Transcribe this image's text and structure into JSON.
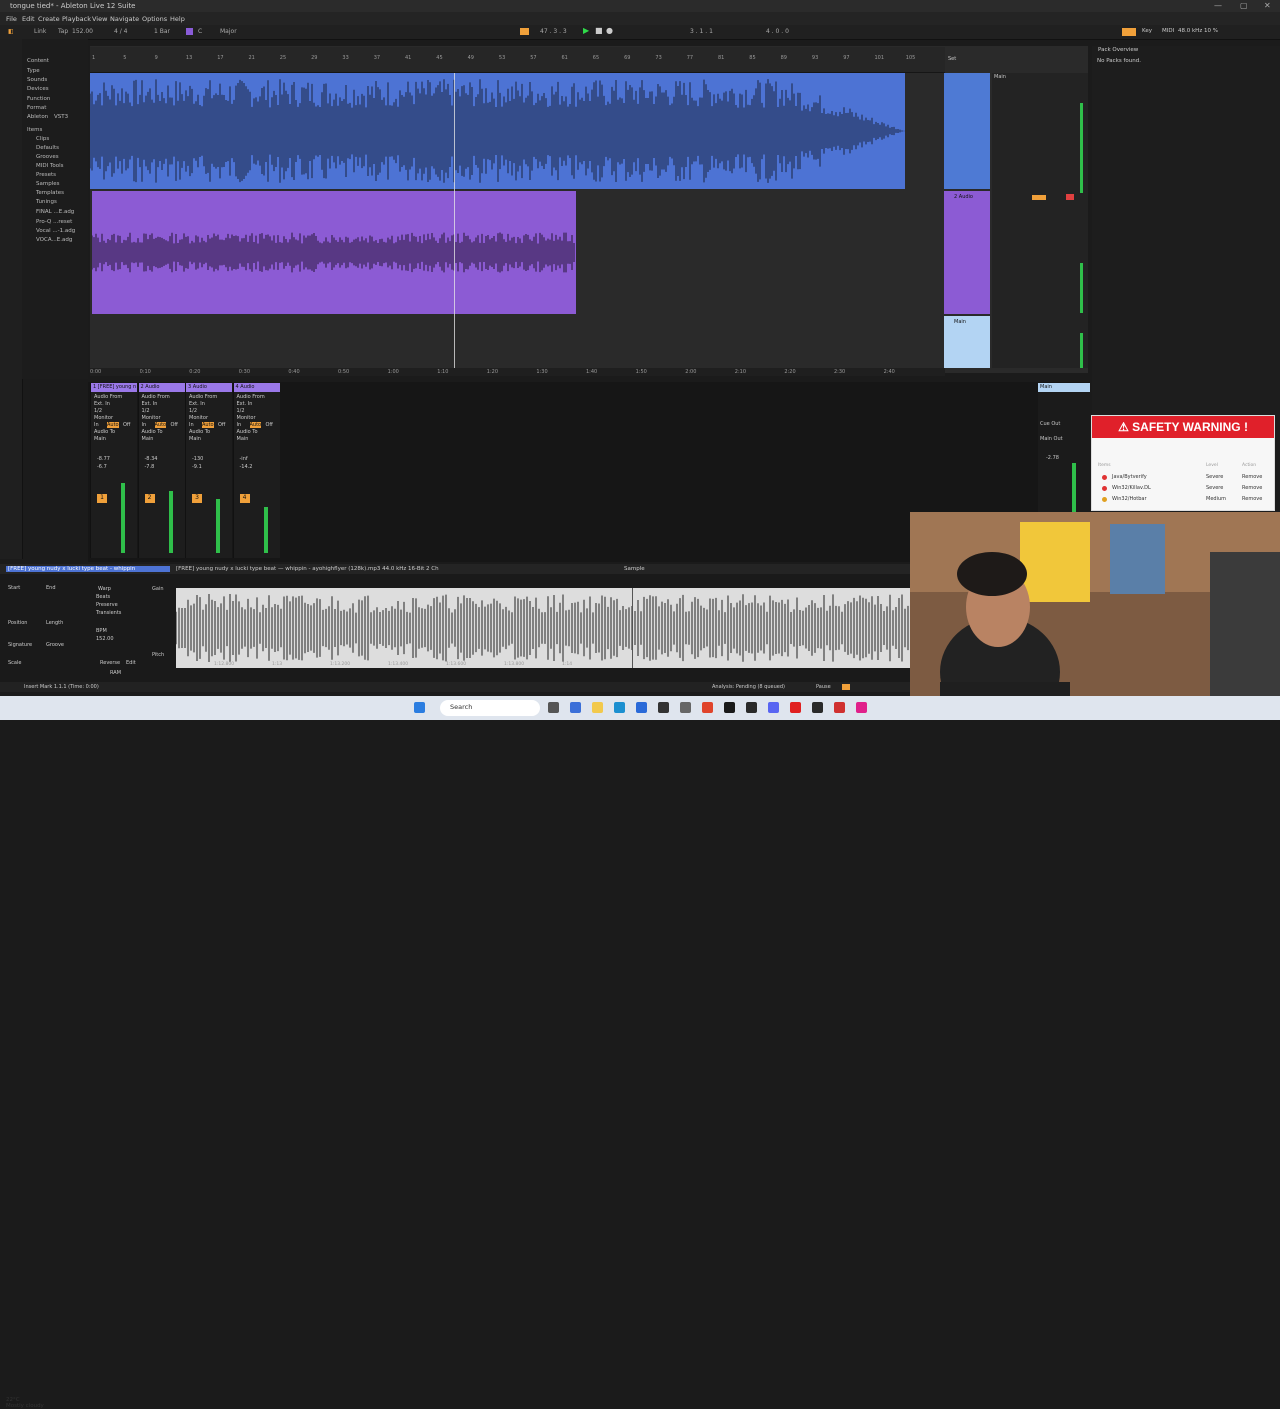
{
  "window": {
    "title": "tongue tied* - Ableton Live 12 Suite",
    "min": "—",
    "max": "▢",
    "close": "✕"
  },
  "menu": [
    "File",
    "Edit",
    "Create",
    "Playback",
    "View",
    "Navigate",
    "Options",
    "Help"
  ],
  "transport": {
    "link": "Link",
    "tap": "Tap",
    "tempo": "152.00",
    "sig": "4 / 4",
    "bar": "1 Bar",
    "key": "C",
    "scale": "Major",
    "position": "47 . 3 . 3",
    "loop_start": "3 . 1 . 1",
    "loop_len": "4 . 0 . 0"
  },
  "top_right": {
    "key": "Key",
    "midi": "MIDI",
    "rate": "48.0 kHz",
    "cpu": "10 %"
  },
  "browser": {
    "items": [
      "Content",
      "Type",
      "Sounds",
      "Devices",
      "Function",
      "Format",
      "Ableton",
      "VST3",
      "Items",
      "Clips",
      "Defaults",
      "Grooves",
      "MIDI Tools",
      "Presets",
      "Samples",
      "Templates",
      "Tunings",
      "FINAL ...E.adg",
      "Pro-Q ...reset",
      "Vocal ...-1.adg",
      "VOCA...E.adg"
    ]
  },
  "ruler_ticks": [
    "1",
    "5",
    "9",
    "13",
    "17",
    "21",
    "25",
    "29",
    "33",
    "37",
    "41",
    "45",
    "49",
    "53",
    "57",
    "61",
    "65",
    "69",
    "73",
    "77",
    "81",
    "85",
    "89",
    "93",
    "97",
    "101",
    "105"
  ],
  "time_ticks": [
    "0:00",
    "0:10",
    "0:20",
    "0:30",
    "0:40",
    "0:50",
    "1:00",
    "1:10",
    "1:20",
    "1:30",
    "1:40",
    "1:50",
    "2:00",
    "2:10",
    "2:20",
    "2:30",
    "2:40"
  ],
  "tracks": {
    "t2": "2 Audio",
    "main": "Main"
  },
  "set_label": "Set",
  "mixer": {
    "strips": [
      {
        "hdr": "1 [FREE] young n",
        "vol": "-8.77",
        "peak": "-6.7",
        "num": "1"
      },
      {
        "hdr": "2 Audio",
        "vol": "-8.34",
        "peak": "-7.8",
        "num": "2"
      },
      {
        "hdr": "3 Audio",
        "vol": "-130",
        "peak": "-9.1",
        "num": "3"
      },
      {
        "hdr": "4 Audio",
        "vol": "-inf",
        "peak": "-14.2",
        "num": "4"
      }
    ],
    "audio_from": "Audio From",
    "ext_in": "Ext. In",
    "ch": "1/2",
    "monitor": "Monitor",
    "in": "In",
    "auto": "Auto",
    "off": "Off",
    "audio_to": "Audio To",
    "main": "Main",
    "master_hdr": "Main",
    "cue_out": "Cue Out",
    "main_out": "Main Out",
    "master_vol": "-2.78"
  },
  "detail": {
    "clip_name": "[FREE] young nudy x lucki type beat - whippin",
    "file_info": "[FREE] young nudy x lucki type beat — whippin - ayohighflyer (128k).mp3  44.0 kHz  16-Bit  2 Ch",
    "sample": "Sample",
    "start": "Start",
    "end": "End",
    "position": "Position",
    "length": "Length",
    "signature": "Signature",
    "groove": "Groove",
    "scale": "Scale",
    "warp": "Warp",
    "beats": "Beats",
    "preserve": "Preserve",
    "transients": "Transients",
    "bpm": "BPM",
    "bpm_val": "152.00",
    "gain": "Gain",
    "pitch": "Pitch",
    "reverse": "Reverse",
    "edit": "Edit",
    "ram": "RAM",
    "time_marks": [
      "1:12.800",
      "1:13",
      "1:13.200",
      "1:13.400",
      "1:13.600",
      "1:13.800",
      "1:14"
    ]
  },
  "status": {
    "left": "Insert Mark 1.1.1 (Time: 0:00)",
    "right": "Analysis: Pending (8 queued)",
    "pause": "Pause"
  },
  "right_panel": {
    "title": "Pack Overview",
    "msg": "No Packs found."
  },
  "safety_popup": {
    "title": "⚠ SAFETY WARNING !",
    "cols": [
      "Items",
      "Level",
      "Action"
    ],
    "rows": [
      {
        "name": "Java/Bytverify",
        "level": "Severe",
        "action": "Remove",
        "dot": "#e03333"
      },
      {
        "name": "Win32/Killav.DL",
        "level": "Severe",
        "action": "Remove",
        "dot": "#e03333"
      },
      {
        "name": "Win32/Hotbar",
        "level": "Medium",
        "action": "Remove",
        "dot": "#e0a020"
      }
    ]
  },
  "taskbar": {
    "search": "Search",
    "temp": "22°C",
    "weather": "Mostly cloudy"
  },
  "colors": {
    "track1": "#4d73d4",
    "track2": "#8c5bd4",
    "main": "#b3d4f3",
    "accent": "#f0a03a",
    "warning": "#e0202a"
  }
}
